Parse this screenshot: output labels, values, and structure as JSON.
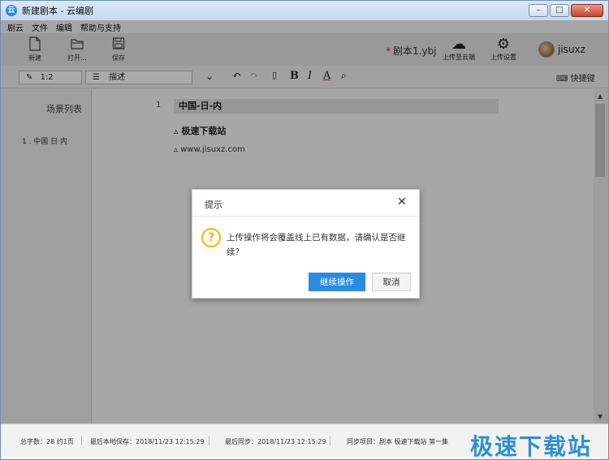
{
  "window": {
    "title": "新建剧本 - 云编剧",
    "controls": {
      "minimize": "–",
      "maximize": "□",
      "close": "✕"
    }
  },
  "menu": [
    "剧云",
    "文件",
    "编辑",
    "帮助与支持"
  ],
  "toolbar": {
    "new_label": "新建",
    "open_label": "打开...",
    "save_label": "保存",
    "file_name": "剧本1.ybj",
    "unsaved_mark": "*",
    "upload_label": "上传至云端",
    "upload_settings_label": "上传设置",
    "username": "jisuxz"
  },
  "format_bar": {
    "position": "1:2",
    "element_type": "描述",
    "bold": "B",
    "italic": "I",
    "color": "A",
    "shortcut_label": "快捷键"
  },
  "sidebar": {
    "title": "场景列表",
    "items": [
      "1 . 中国 日 内"
    ]
  },
  "editor": {
    "line_number": "1",
    "scene_heading": "中国-日-内",
    "character": "极速下载站",
    "dialogue": "www.jisuxz.com"
  },
  "status": {
    "word_count": "总字数：28 约1页",
    "last_local_save": "最后本地保存：2018/11/23 12:15:29",
    "last_sync": "最后同步：2018/11/23 12:15:29",
    "sync_item": "同步项目：剧本 极速下载站 第一集"
  },
  "watermark": "极速下载站",
  "dialog": {
    "title": "提示",
    "message": "上传操作将会覆盖线上已有数据，请确认是否继续？",
    "confirm_label": "继续操作",
    "cancel_label": "取消"
  },
  "colors": {
    "accent": "#2a8be0",
    "warning": "#f0b400"
  }
}
